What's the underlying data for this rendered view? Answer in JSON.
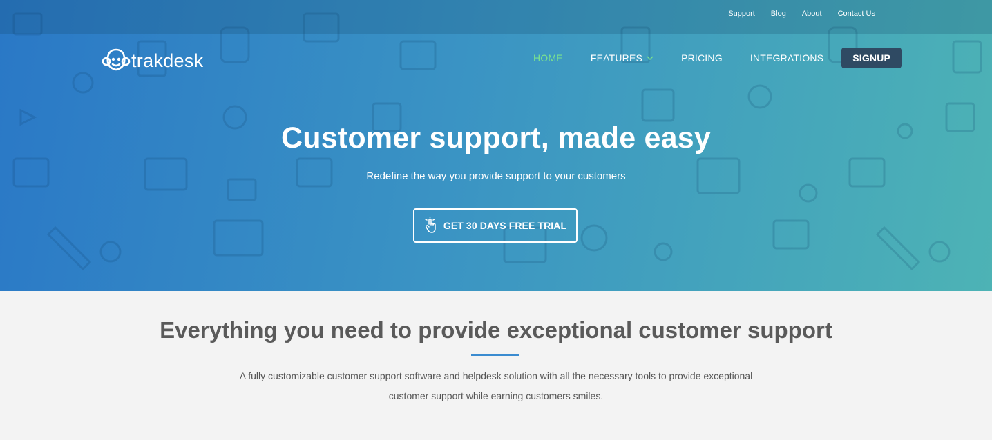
{
  "top_links": [
    "Support",
    "Blog",
    "About",
    "Contact Us"
  ],
  "logo": {
    "text": "trakdesk"
  },
  "nav": {
    "home": "HOME",
    "features": "FEATURES",
    "pricing": "PRICING",
    "integrations": "INTEGRATIONS",
    "signup": "SIGNUP"
  },
  "hero": {
    "title": "Customer support, made easy",
    "subtitle": "Redefine the way you provide support to your customers",
    "cta": "GET 30 DAYS FREE TRIAL"
  },
  "section": {
    "title": "Everything you need to provide exceptional customer support",
    "text": "A fully customizable customer support software and helpdesk solution with all the necessary tools to provide exceptional customer support while earning customers smiles."
  },
  "colors": {
    "active_nav": "#7be38e",
    "signup_bg": "#2f4a63",
    "divider": "#3a8bd0"
  }
}
